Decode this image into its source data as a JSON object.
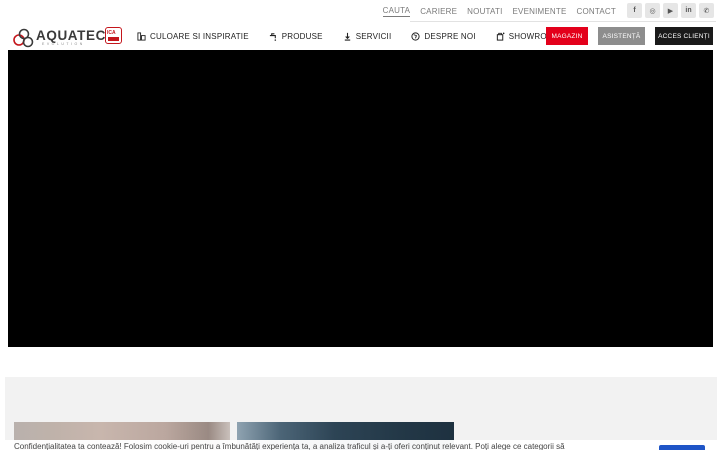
{
  "topbar": {
    "links": [
      "CAUTA",
      "CARIERE",
      "NOUTATI",
      "EVENIMENTE",
      "CONTACT"
    ],
    "socials": [
      "f",
      "◎",
      "▶",
      "in",
      "✆"
    ]
  },
  "logo": {
    "name": "AQUATEC",
    "sub": "EVOLUTION",
    "badge": "ICA"
  },
  "nav": {
    "items": [
      {
        "label": "CULOARE SI INSPIRATIE",
        "icon": "palette-icon"
      },
      {
        "label": "PRODUSE",
        "icon": "faucet-icon"
      },
      {
        "label": "SERVICII",
        "icon": "tools-icon"
      },
      {
        "label": "DESPRE NOI",
        "icon": "globe-icon"
      },
      {
        "label": "SHOWROOM",
        "icon": "store-icon"
      }
    ],
    "buttons": {
      "magazin": "MAGAZIN",
      "asistenta": "ASISTENȚĂ",
      "acces": "ACCES CLIENȚI"
    }
  },
  "cookie": {
    "text": "Confidențialitatea ta contează! Folosim cookie-uri pentru a îmbunătăți experiența ta, a analiza traficul și a-ți oferi conținut relevant. Poți alege ce categorii să"
  },
  "colors": {
    "accent_red": "#e3001b",
    "grey_button": "#8d8d8d",
    "dark_button": "#1a1a1a",
    "cookie_button": "#1f55c7"
  }
}
